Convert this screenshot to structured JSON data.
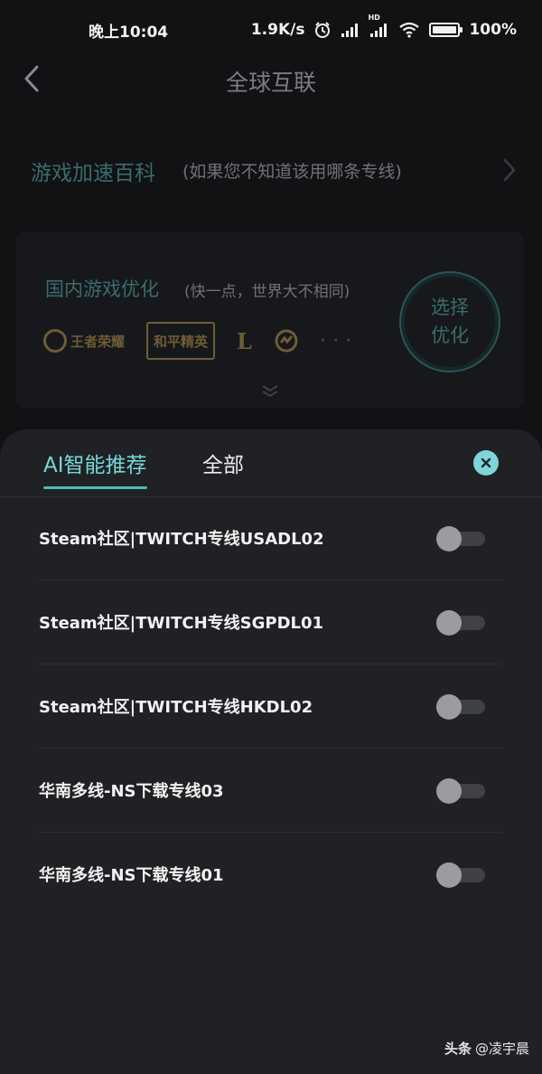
{
  "status_bar": {
    "time": "晚上10:04",
    "net_speed": "1.9K/s",
    "battery_level": 100,
    "battery_text": "100%",
    "hd_label": "HD",
    "icons": [
      "alarm-icon",
      "signal-icon",
      "hd-signal-icon",
      "wifi-icon",
      "battery-icon"
    ]
  },
  "header": {
    "title": "全球互联",
    "back_icon": "back-chevron-icon"
  },
  "encyclopedia": {
    "title": "游戏加速百科",
    "subtitle": "(如果您不知道该用哪条专线)"
  },
  "promo": {
    "title": "国内游戏优化",
    "subtitle": "(快一点，世界大不相同)",
    "logos": [
      "王者荣耀",
      "和平精英",
      "L",
      "...",
      "· · ·"
    ],
    "select_button": "选择优化"
  },
  "sheet": {
    "tabs": [
      {
        "label": "AI智能推荐",
        "active": true
      },
      {
        "label": "全部",
        "active": false
      }
    ],
    "lines": [
      {
        "name": "Steam社区|TWITCH专线USADL02",
        "enabled": false
      },
      {
        "name": "Steam社区|TWITCH专线SGPDL01",
        "enabled": false
      },
      {
        "name": "Steam社区|TWITCH专线HKDL02",
        "enabled": false
      },
      {
        "name": "华南多线-NS下载专线03",
        "enabled": false
      },
      {
        "name": "华南多线-NS下载专线01",
        "enabled": false
      }
    ]
  },
  "watermark": {
    "brand": "头条",
    "author": "@凌宇晨"
  },
  "colors": {
    "accent": "#76d6da",
    "sheet_bg": "#202124",
    "screen_bg": "#111214",
    "toggle_off_knob": "#9b9c9e"
  }
}
